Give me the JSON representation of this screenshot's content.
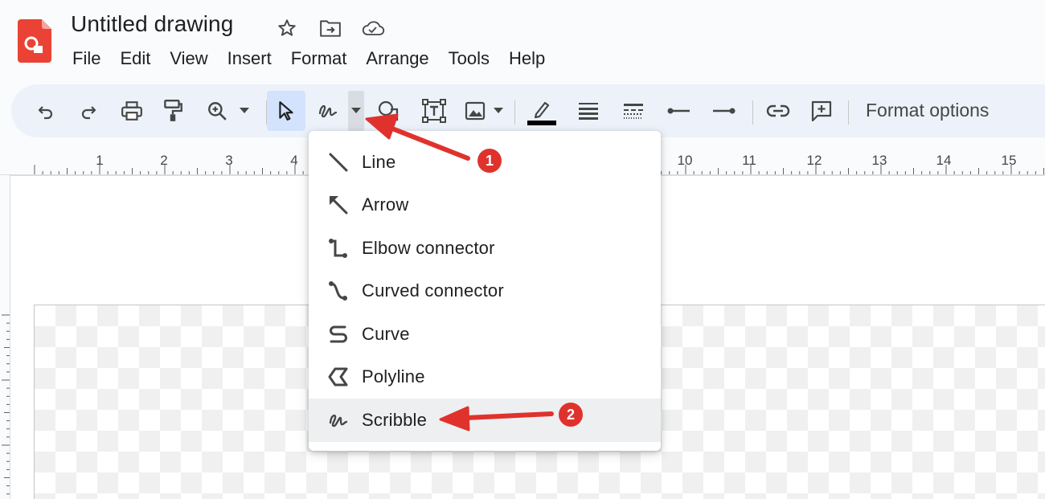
{
  "header": {
    "title": "Untitled drawing",
    "menu": [
      "File",
      "Edit",
      "View",
      "Insert",
      "Format",
      "Arrange",
      "Tools",
      "Help"
    ]
  },
  "toolbar": {
    "format_options_label": "Format options",
    "icons": [
      "undo-icon",
      "redo-icon",
      "print-icon",
      "paint-format-icon",
      "zoom-icon",
      "select-icon",
      "line-scribble-icon",
      "shape-icon",
      "text-box-icon",
      "image-icon",
      "line-color-icon",
      "line-weight-icon",
      "line-dash-icon",
      "line-start-icon",
      "line-end-icon",
      "link-icon",
      "comment-icon"
    ]
  },
  "ruler": {
    "labels": [
      "1",
      "2",
      "3",
      "4",
      "10",
      "11",
      "12",
      "13",
      "14",
      "15"
    ]
  },
  "dropdown": {
    "items": [
      {
        "label": "Line",
        "icon": "line-icon"
      },
      {
        "label": "Arrow",
        "icon": "arrow-icon"
      },
      {
        "label": "Elbow connector",
        "icon": "elbow-connector-icon"
      },
      {
        "label": "Curved connector",
        "icon": "curved-connector-icon"
      },
      {
        "label": "Curve",
        "icon": "curve-icon"
      },
      {
        "label": "Polyline",
        "icon": "polyline-icon"
      },
      {
        "label": "Scribble",
        "icon": "scribble-icon"
      }
    ],
    "highlighted": "Scribble"
  },
  "annotations": {
    "badge1": "1",
    "badge2": "2"
  },
  "colors": {
    "toolbar_bg": "#edf2fa",
    "active_button": "#d3e3fd",
    "annotation_red": "#e0322d",
    "logo_red": "#ea4335"
  }
}
